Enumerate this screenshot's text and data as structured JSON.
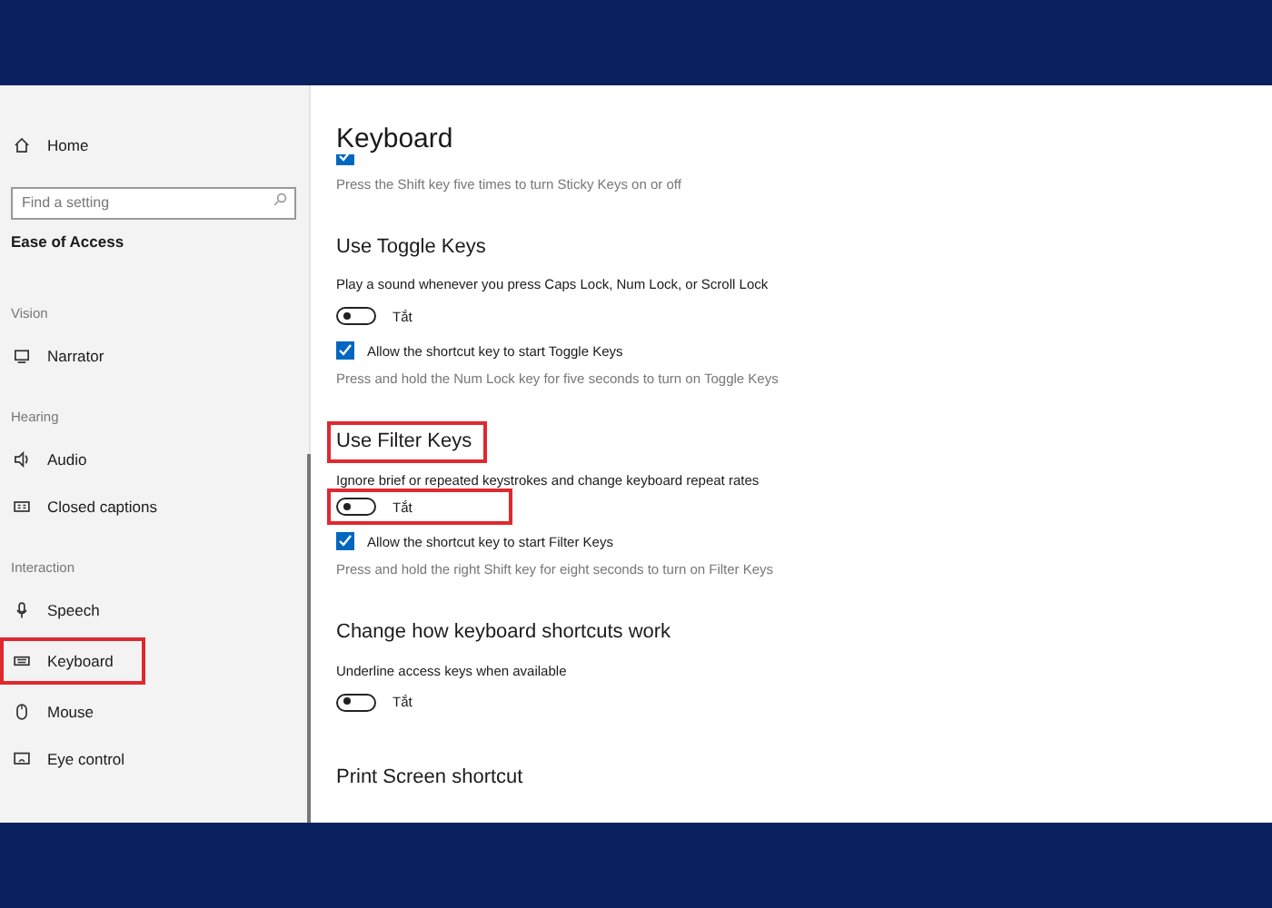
{
  "sidebar": {
    "home": "Home",
    "search": {
      "placeholder": "Find a setting"
    },
    "section_title": "Ease of Access",
    "groups": [
      {
        "label": "Vision",
        "items": [
          {
            "label": "Narrator",
            "highlighted": false
          }
        ]
      },
      {
        "label": "Hearing",
        "items": [
          {
            "label": "Audio",
            "highlighted": false
          },
          {
            "label": "Closed captions",
            "highlighted": false
          }
        ]
      },
      {
        "label": "Interaction",
        "items": [
          {
            "label": "Speech",
            "highlighted": false
          },
          {
            "label": "Keyboard",
            "highlighted": true
          },
          {
            "label": "Mouse",
            "highlighted": false
          },
          {
            "label": "Eye control",
            "highlighted": false
          }
        ]
      }
    ]
  },
  "main": {
    "title": "Keyboard",
    "sections": [
      {
        "rows": [
          {
            "kind": "checkbox",
            "checked": true
          },
          {
            "kind": "note",
            "text": "Press the Shift key five times to turn Sticky Keys on or off"
          }
        ]
      },
      {
        "heading": "Use Toggle Keys",
        "highlighted": false,
        "rows": [
          {
            "kind": "description",
            "text": "Play a sound whenever you press Caps Lock, Num Lock, or Scroll Lock"
          },
          {
            "kind": "toggle",
            "on": false,
            "label": "Tắt",
            "highlighted": false
          },
          {
            "kind": "checkbox",
            "checked": true,
            "label": "Allow the shortcut key to start Toggle Keys"
          },
          {
            "kind": "note",
            "text": "Press and hold the Num Lock key for five seconds to turn on Toggle Keys"
          }
        ]
      },
      {
        "heading": "Use Filter Keys",
        "highlighted": true,
        "rows": [
          {
            "kind": "description",
            "text": "Ignore brief or repeated keystrokes and change keyboard repeat rates"
          },
          {
            "kind": "toggle",
            "on": false,
            "label": "Tắt",
            "highlighted": true
          },
          {
            "kind": "checkbox",
            "checked": true,
            "label": "Allow the shortcut key to start Filter Keys"
          },
          {
            "kind": "note",
            "text": "Press and hold the right Shift key for eight seconds to turn on Filter Keys"
          }
        ]
      },
      {
        "heading": "Change how keyboard shortcuts work",
        "highlighted": false,
        "rows": [
          {
            "kind": "description",
            "text": "Underline access keys when available"
          },
          {
            "kind": "toggle",
            "on": false,
            "label": "Tắt",
            "highlighted": false
          }
        ]
      },
      {
        "heading": "Print Screen shortcut",
        "highlighted": false
      }
    ]
  }
}
